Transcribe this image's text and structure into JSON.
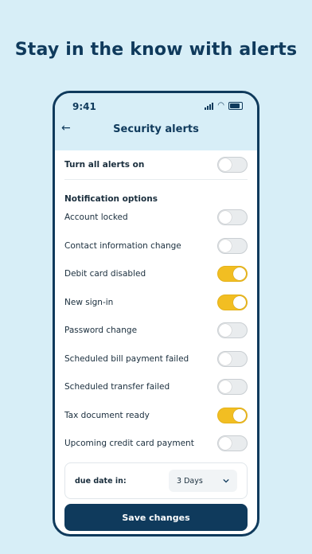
{
  "headline": "Stay in the know with alerts",
  "status_bar": {
    "time": "9:41"
  },
  "header": {
    "title": "Security alerts",
    "back_icon": "back-arrow-icon"
  },
  "master": {
    "label": "Turn all alerts on",
    "on": false
  },
  "section_title": "Notification options",
  "options": [
    {
      "label": "Account locked",
      "on": false
    },
    {
      "label": "Contact information change",
      "on": false
    },
    {
      "label": "Debit card disabled",
      "on": true
    },
    {
      "label": "New sign-in",
      "on": true
    },
    {
      "label": "Password change",
      "on": false
    },
    {
      "label": "Scheduled bill payment failed",
      "on": false
    },
    {
      "label": "Scheduled transfer failed",
      "on": false
    },
    {
      "label": "Tax document ready",
      "on": true
    },
    {
      "label": "Upcoming credit card payment",
      "on": false
    }
  ],
  "due_date": {
    "label": "due date in:",
    "value": "3 Days"
  },
  "save_label": "Save changes",
  "colors": {
    "primary": "#0f3a5c",
    "toggle_on": "#f2be22",
    "background": "#d7eef7"
  }
}
